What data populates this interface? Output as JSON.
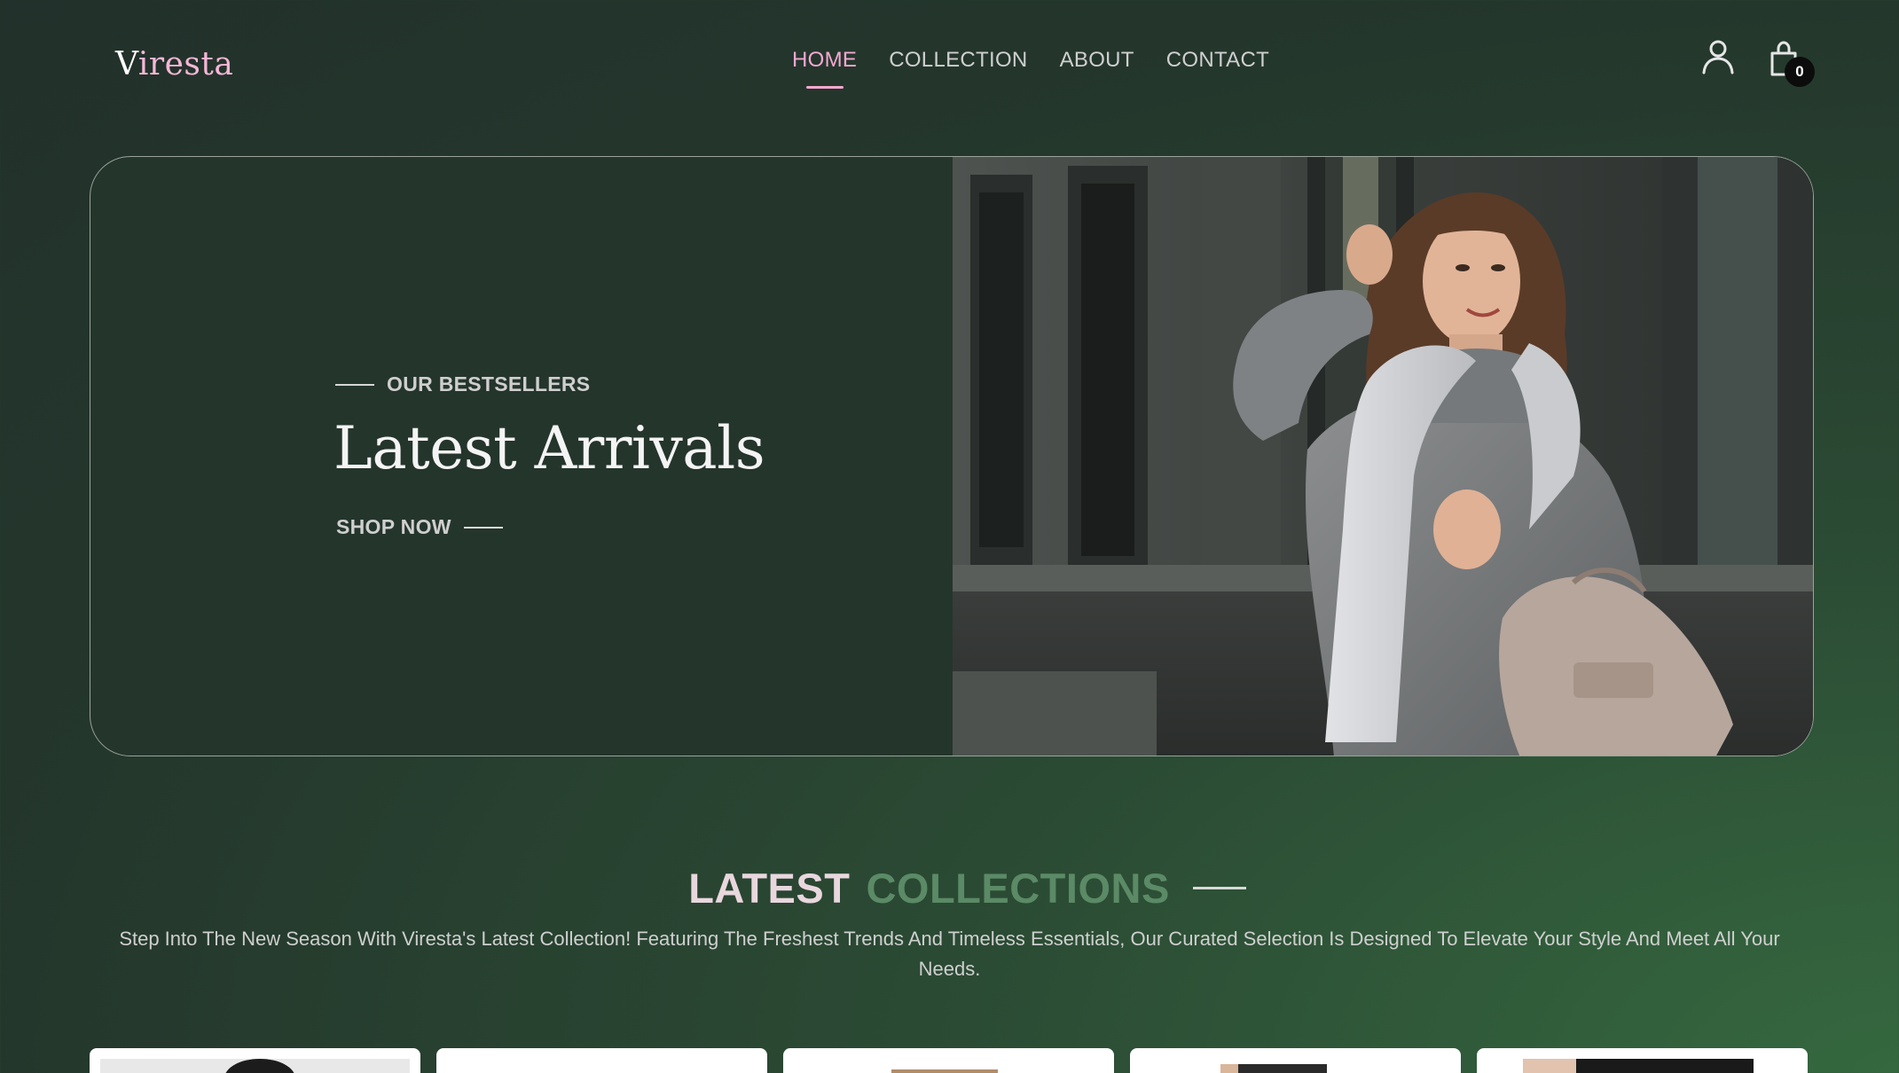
{
  "brand": {
    "first_letter": "V",
    "rest": "iresta"
  },
  "nav": {
    "items": [
      {
        "label": "HOME",
        "active": true
      },
      {
        "label": "COLLECTION",
        "active": false
      },
      {
        "label": "ABOUT",
        "active": false
      },
      {
        "label": "CONTACT",
        "active": false
      }
    ]
  },
  "header_icons": {
    "user": "user-icon",
    "cart": "shopping-bag-icon",
    "cart_count": "0"
  },
  "hero": {
    "eyebrow": "OUR BESTSELLERS",
    "title": "Latest Arrivals",
    "cta": "SHOP NOW"
  },
  "collections": {
    "title_part1": "LATEST",
    "title_part2": "COLLECTIONS",
    "description": "Step Into The New Season With Viresta's Latest Collection! Featuring The Freshest Trends And Timeless Essentials, Our Curated Selection Is Designed To Elevate Your Style And Meet All Your Needs."
  },
  "colors": {
    "accent_pink": "#f5a8d1",
    "accent_green": "#5b8a66",
    "background_dark": "#24352c"
  }
}
